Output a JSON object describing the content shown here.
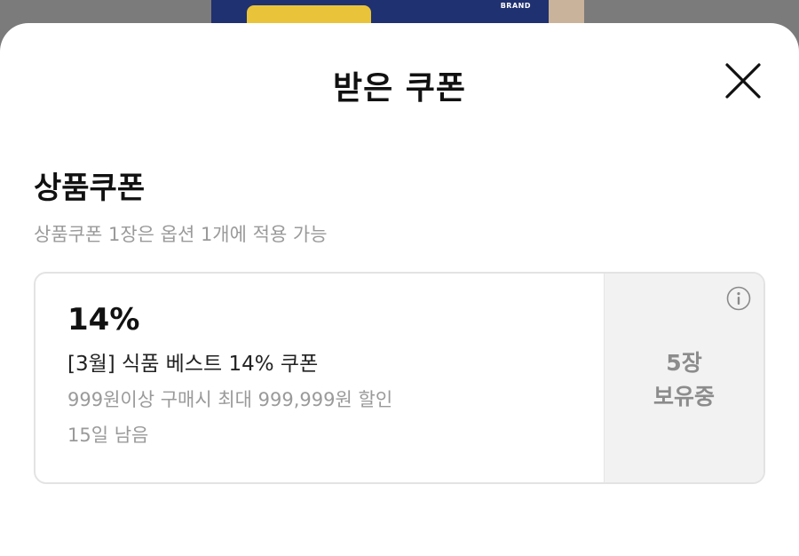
{
  "background": {
    "brand_tag": "BRAND"
  },
  "sheet": {
    "title": "받은 쿠폰",
    "close_icon": "close-icon"
  },
  "section": {
    "title": "상품쿠폰",
    "description": "상품쿠폰 1장은 옵션 1개에 적용 가능"
  },
  "coupon": {
    "rate": "14%",
    "name": "[3월] 식품 베스트 14% 쿠폰",
    "condition": "999원이상 구매시 최대 999,999원 할인",
    "remaining": "15일 남음",
    "held_count": "5장",
    "held_label": "보유중",
    "info_icon": "info-icon"
  },
  "colors": {
    "overlay": "#7b7b7b",
    "sheet": "#ffffff",
    "text_primary": "#111111",
    "text_secondary": "#9a9a9a",
    "side_panel": "#f2f2f2",
    "border": "#e3e3e3"
  }
}
